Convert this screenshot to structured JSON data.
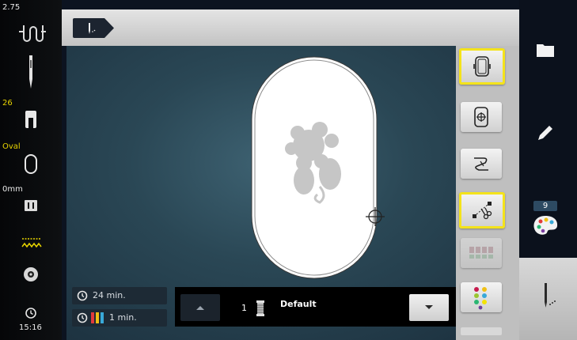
{
  "status": {
    "tension": "2.75",
    "presser_foot_number": "26",
    "hoop_name": "Oval",
    "foot_height": "0mm",
    "clock": "15:16"
  },
  "right_nav": {
    "palette_badge": "9"
  },
  "info": {
    "total_time": "24 min.",
    "color_time": "1 min."
  },
  "color_selector": {
    "number": "1",
    "name": "Default"
  },
  "colors": {
    "selected_outline": "#f4e31b",
    "status_yellow": "#e8d400",
    "background": "#2a4755"
  }
}
